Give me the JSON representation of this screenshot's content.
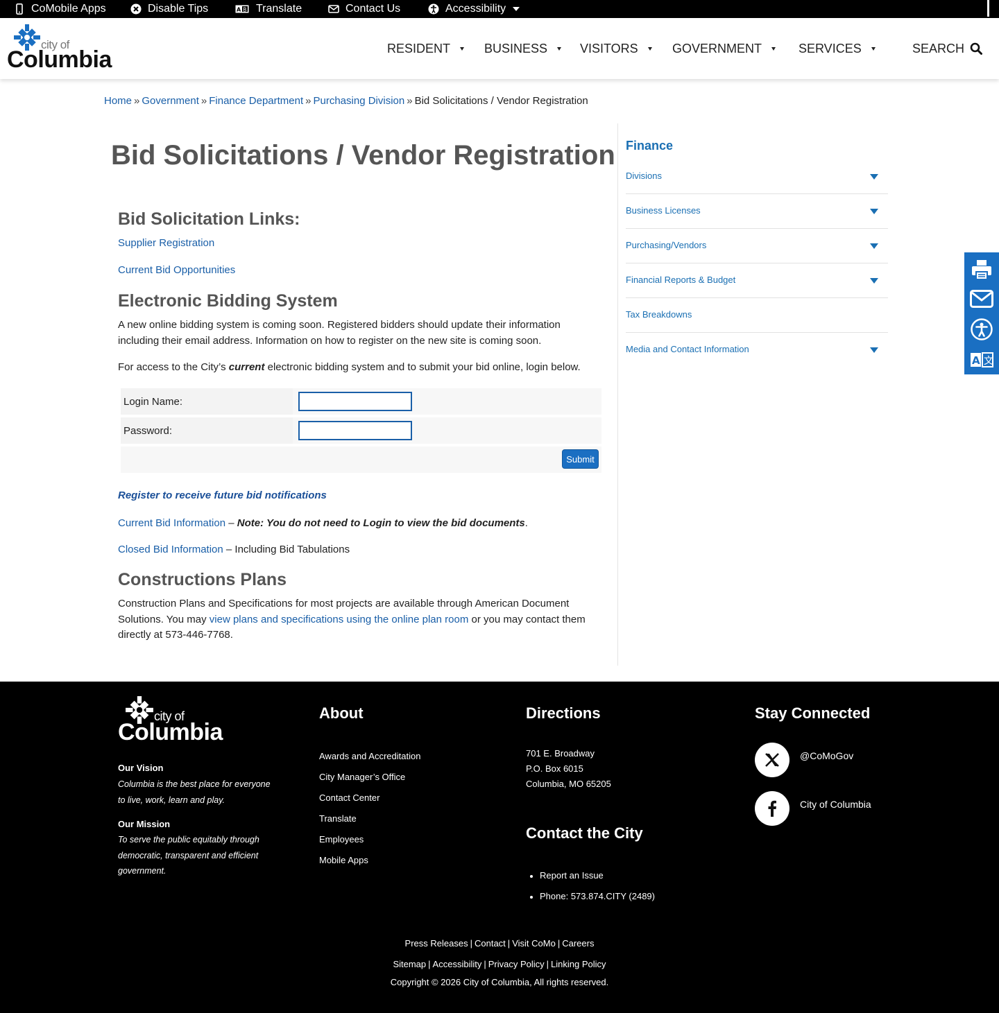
{
  "topbar": {
    "items": [
      {
        "label": "CoMobile Apps",
        "icon": "phone-icon"
      },
      {
        "label": "Disable Tips",
        "icon": "close-circle-icon"
      },
      {
        "label": "Translate",
        "icon": "translate-icon"
      },
      {
        "label": "Contact Us",
        "icon": "envelope-icon"
      },
      {
        "label": "Accessibility",
        "icon": "accessibility-icon"
      }
    ]
  },
  "header": {
    "logo": {
      "city_of": "city of",
      "name": "Columbia"
    },
    "nav": [
      "RESIDENT",
      "BUSINESS",
      "VISITORS",
      "GOVERNMENT",
      "SERVICES"
    ],
    "search_label": "SEARCH"
  },
  "breadcrumb": [
    "Home",
    "Government",
    "Finance Department",
    "Purchasing Division",
    "Bid Solicitations / Vendor Registration"
  ],
  "breadcrumb_sep": "»",
  "main": {
    "title": "Bid Solicitations / Vendor Registration",
    "links_heading": "Bid Solicitation Links:",
    "link_supplier": "Supplier Registration",
    "link_current_opps": "Current Bid Opportunities",
    "ebs_heading": "Electronic Bidding System",
    "ebs_para": "A new online bidding system is coming soon. Registered bidders should update their information including their email address. Information on how to register on the new site is coming soon.",
    "access_pre": "For access  to the City’s ",
    "access_em": "current",
    "access_post": " electronic bidding system and to submit your bid online, login below.",
    "login_label": "Login Name:",
    "password_label": "Password:",
    "login_value": "",
    "password_value": "",
    "submit_label": "Submit",
    "register_link": "Register to receive future bid notifications",
    "current_bid_link": "Current Bid Information",
    "current_bid_dash": " – ",
    "current_bid_note": "Note: You do not need to Login to view the bid documents",
    "current_bid_period": ".",
    "closed_bid_link": "Closed Bid Information",
    "closed_bid_rest": " – Including Bid Tabulations",
    "plans_heading": "Constructions Plans",
    "plans_pre": "Construction Plans and Specifications for most projects are available through American Document Solutions. You may ",
    "plans_link": "view plans and specifications using the online plan room",
    "plans_post": "  or you may contact them directly at 573-446-7768."
  },
  "sidebar": {
    "title": "Finance",
    "items": [
      {
        "label": "Divisions",
        "expandable": true
      },
      {
        "label": "Business Licenses",
        "expandable": true
      },
      {
        "label": "Purchasing/Vendors",
        "expandable": true
      },
      {
        "label": "Financial Reports & Budget",
        "expandable": true
      },
      {
        "label": "Tax Breakdowns",
        "expandable": false
      },
      {
        "label": "Media and Contact Information",
        "expandable": true
      }
    ]
  },
  "tools": [
    "print-icon",
    "email-icon",
    "accessibility-icon",
    "translate-icon"
  ],
  "footer": {
    "logo": {
      "city_of": "city of",
      "name": "Columbia"
    },
    "vision_heading": "Our Vision",
    "vision_text": "Columbia is the best place for everyone to live, work, learn and play.",
    "mission_heading": "Our Mission",
    "mission_text": "To serve the public equitably through democratic, transparent and efficient government.",
    "about_heading": "About",
    "about_links": [
      "Awards and Accreditation",
      "City Manager’s Office",
      "Contact Center",
      "Translate",
      "Employees",
      "Mobile Apps"
    ],
    "directions_heading": "Directions",
    "address": [
      "701 E. Broadway",
      "P.O. Box 6015",
      "Columbia, MO 65205"
    ],
    "contact_heading": "Contact the City",
    "contact_items": [
      "Report an Issue",
      "Phone: 573.874.CITY (2489)"
    ],
    "stay_heading": "Stay Connected",
    "social": [
      {
        "label": "@CoMoGov",
        "icon": "x-twitter-icon"
      },
      {
        "label": "City of Columbia",
        "icon": "facebook-icon"
      }
    ],
    "bottom_row1": [
      "Press Releases",
      "Contact",
      "Visit CoMo",
      "Careers"
    ],
    "bottom_row2": [
      "Sitemap",
      "Accessibility",
      "Privacy Policy",
      "Linking Policy"
    ],
    "copyright": "Copyright © 2026 City of Columbia, All rights reserved."
  },
  "colors": {
    "link": "#1a5fa8",
    "accent": "#1a6fc2",
    "footer_bg": "#000000"
  }
}
